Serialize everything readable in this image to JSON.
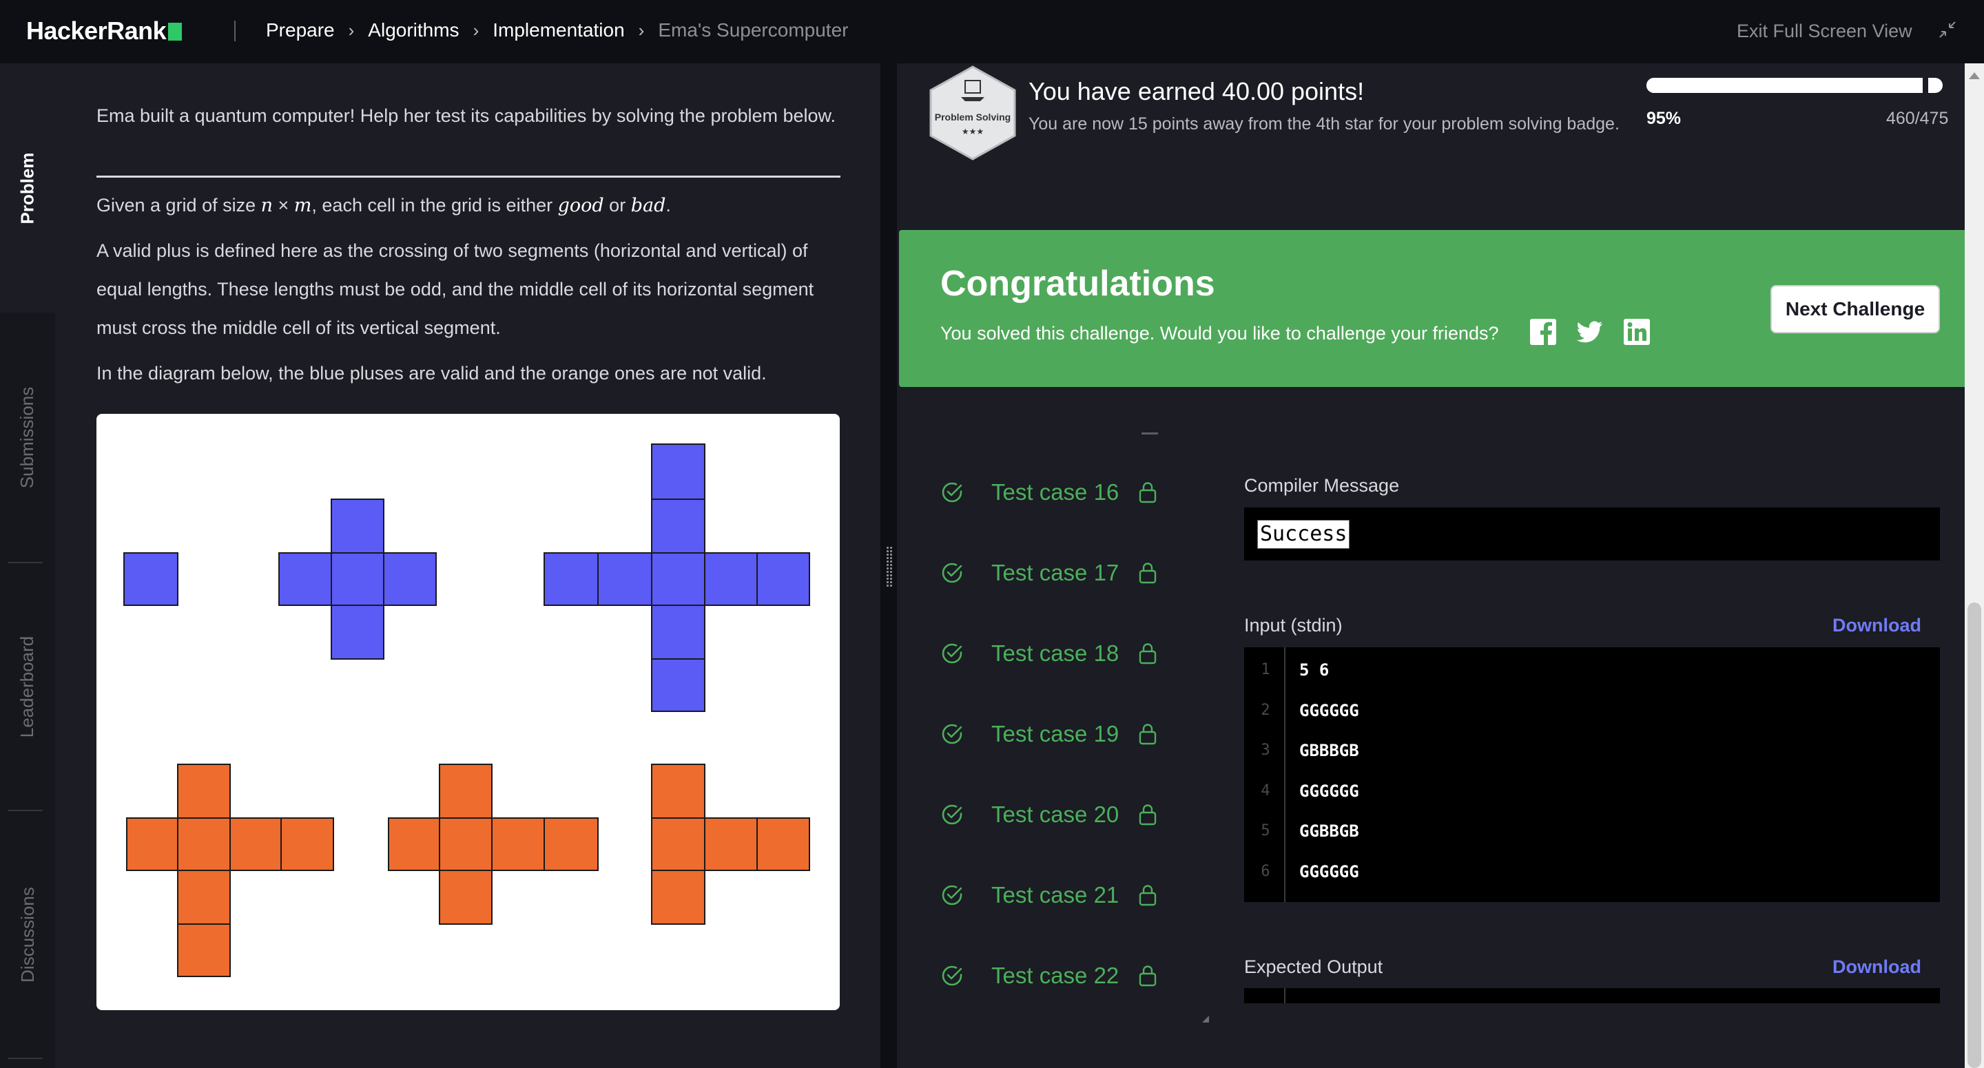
{
  "header": {
    "logo": "HackerRank",
    "breadcrumbs": [
      "Prepare",
      "Algorithms",
      "Implementation"
    ],
    "current": "Ema's Supercomputer",
    "exit_fullscreen": "Exit Full Screen View"
  },
  "sidebar": {
    "tabs": [
      {
        "label": "Problem",
        "active": true
      },
      {
        "label": "Submissions",
        "active": false
      },
      {
        "label": "Leaderboard",
        "active": false
      },
      {
        "label": "Discussions",
        "active": false
      }
    ]
  },
  "problem": {
    "intro": "Ema built a quantum computer! Help her test its capabilities by solving the problem below.",
    "grid_pre": "Given a grid of size ",
    "grid_n": "n",
    "grid_times": " × ",
    "grid_m": "m",
    "grid_mid": ", each cell in the grid is either ",
    "grid_good": "good",
    "grid_or": " or ",
    "grid_bad": "bad",
    "grid_end": ".",
    "plus_def": "A valid plus is defined here as the crossing of two segments (horizontal and vertical) of equal lengths. These lengths must be odd, and the middle cell of its horizontal segment must cross the middle cell of its vertical segment.",
    "diagram_caption": "In the diagram below, the blue pluses are valid and the orange ones are not valid.",
    "colors": {
      "valid": "#5b5bf5",
      "invalid": "#ee6c2e"
    }
  },
  "results": {
    "badge_name": "Problem Solving",
    "badge_stars": "★★★",
    "earned_title": "You have earned 40.00 points!",
    "earned_sub": "You are now 15 points away from the 4th star for your problem solving badge.",
    "progress_pct": "95%",
    "progress_value": 0.95,
    "progress_points": "460/475",
    "congrats_title": "Congratulations",
    "congrats_text": "You solved this challenge. Would you like to challenge your friends?",
    "next_button": "Next Challenge",
    "test_cases": [
      "Test case 16",
      "Test case 17",
      "Test case 18",
      "Test case 19",
      "Test case 20",
      "Test case 21",
      "Test case 22"
    ],
    "compiler_label": "Compiler Message",
    "compiler_message": "Success",
    "input_label": "Input (stdin)",
    "download_label": "Download",
    "input_lines": [
      {
        "n": "1",
        "text": "5 6"
      },
      {
        "n": "2",
        "text": "GGGGGG"
      },
      {
        "n": "3",
        "text": "GBBBGB"
      },
      {
        "n": "4",
        "text": "GGGGGG"
      },
      {
        "n": "5",
        "text": "GGBBGB"
      },
      {
        "n": "6",
        "text": "GGGGGG"
      }
    ],
    "expected_label": "Expected Output",
    "accent": "#4fa95a",
    "link_color": "#6f7bf7"
  }
}
